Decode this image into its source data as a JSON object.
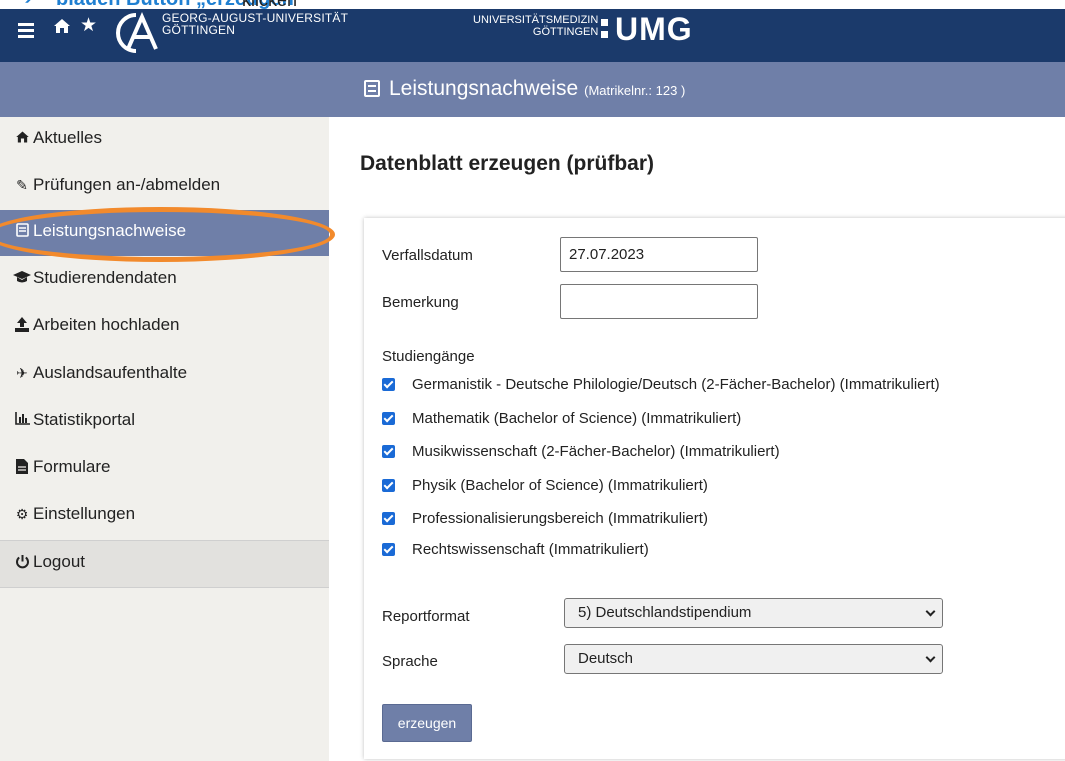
{
  "instruction": {
    "arrow": "➔",
    "highlight": "blauen Button „erzeugen“",
    "rest": "klicken"
  },
  "header": {
    "university_name": [
      "GEORG-AUGUST-UNIVERSITÄT",
      "GÖTTINGEN"
    ],
    "umg_text": [
      "UNIVERSITÄTSMEDIZIN",
      "GÖTTINGEN"
    ],
    "umg_logo": "UMG",
    "icons": [
      "menu-icon",
      "home-icon",
      "star-icon"
    ]
  },
  "titlebar": {
    "title": "Leistungsnachweise",
    "subtitle": "(Matrikelnr.: 123 )"
  },
  "sidebar": {
    "items": [
      {
        "label": "Aktuelles",
        "icon": "home-icon"
      },
      {
        "label": "Prüfungen an-/abmelden",
        "icon": "edit-icon"
      },
      {
        "label": "Leistungsnachweise",
        "icon": "document-icon",
        "active": true
      },
      {
        "label": "Studierendendaten",
        "icon": "graduation-cap-icon"
      },
      {
        "label": "Arbeiten hochladen",
        "icon": "upload-icon"
      },
      {
        "label": "Auslandsaufenthalte",
        "icon": "plane-icon"
      },
      {
        "label": "Statistikportal",
        "icon": "bar-chart-icon"
      },
      {
        "label": "Formulare",
        "icon": "file-icon"
      },
      {
        "label": "Einstellungen",
        "icon": "gear-icon"
      },
      {
        "label": "Logout",
        "icon": "power-icon"
      }
    ]
  },
  "main": {
    "title": "Datenblatt erzeugen (prüfbar)",
    "expiry_label": "Verfallsdatum",
    "expiry_value": "27.07.2023",
    "remark_label": "Bemerkung",
    "remark_value": "",
    "programs_label": "Studiengänge",
    "programs": [
      {
        "label": "Germanistik - Deutsche Philologie/Deutsch (2-Fächer-Bachelor) (Immatrikuliert)",
        "checked": true
      },
      {
        "label": "Mathematik (Bachelor of Science) (Immatrikuliert)",
        "checked": true
      },
      {
        "label": "Musikwissenschaft (2-Fächer-Bachelor) (Immatrikuliert)",
        "checked": true
      },
      {
        "label": "Physik (Bachelor of Science) (Immatrikuliert)",
        "checked": true
      },
      {
        "label": "Professionalisierungsbereich (Immatrikuliert)",
        "checked": true
      },
      {
        "label": "Rechtswissenschaft (Immatrikuliert)",
        "checked": true
      }
    ],
    "report_label": "Reportformat",
    "report_value": "5) Deutschlandstipendium",
    "language_label": "Sprache",
    "language_value": "Deutsch",
    "submit_label": "erzeugen"
  },
  "colors": {
    "header": "#1b3a6b",
    "accent": "#6f7fa8",
    "highlight_ring": "#f28a2c",
    "checkbox": "#1a6ad6",
    "instruction_text": "#1f7fd1"
  }
}
